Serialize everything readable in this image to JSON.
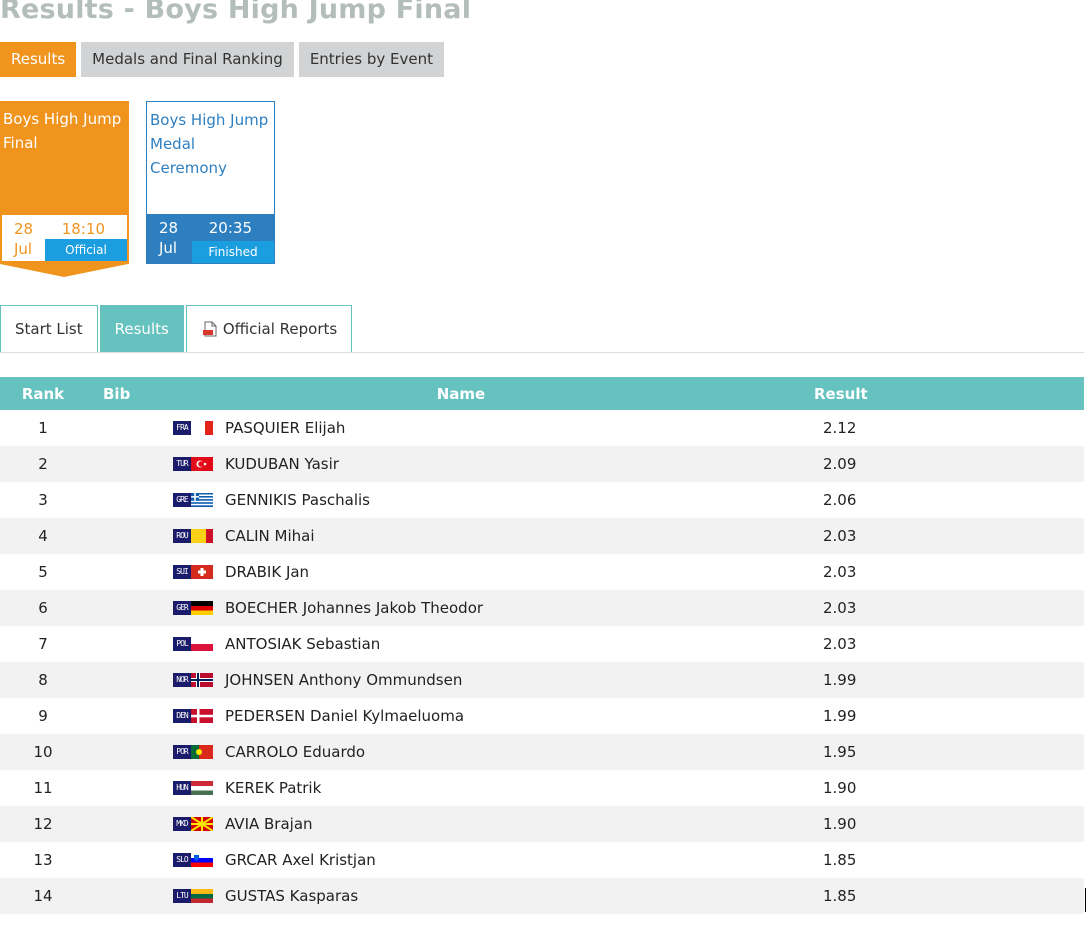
{
  "page_title": "Results - Boys High Jump Final",
  "top_tabs": [
    {
      "label": "Results",
      "active": true
    },
    {
      "label": "Medals and Final Ranking",
      "active": false
    },
    {
      "label": "Entries by Event",
      "active": false
    }
  ],
  "event_cards": [
    {
      "title": "Boys High Jump Final",
      "day": "28",
      "month": "Jul",
      "time": "18:10",
      "status": "Official",
      "selected": true
    },
    {
      "title": "Boys High Jump Medal Ceremony",
      "day": "28",
      "month": "Jul",
      "time": "20:35",
      "status": "Finished",
      "selected": false
    }
  ],
  "sub_tabs": [
    {
      "label": "Start List",
      "active": false
    },
    {
      "label": "Results",
      "active": true
    },
    {
      "label": "Official Reports",
      "active": false,
      "icon": "pdf-document-icon"
    }
  ],
  "table": {
    "headers": {
      "rank": "Rank",
      "bib": "Bib",
      "name": "Name",
      "result": "Result"
    },
    "rows": [
      {
        "rank": "1",
        "bib": "",
        "noc": "FRA",
        "name": "PASQUIER Elijah",
        "result": "2.12"
      },
      {
        "rank": "2",
        "bib": "",
        "noc": "TUR",
        "name": "KUDUBAN Yasir",
        "result": "2.09"
      },
      {
        "rank": "3",
        "bib": "",
        "noc": "GRE",
        "name": "GENNIKIS Paschalis",
        "result": "2.06"
      },
      {
        "rank": "4",
        "bib": "",
        "noc": "ROU",
        "name": "CALIN Mihai",
        "result": "2.03"
      },
      {
        "rank": "5",
        "bib": "",
        "noc": "SUI",
        "name": "DRABIK Jan",
        "result": "2.03"
      },
      {
        "rank": "6",
        "bib": "",
        "noc": "GER",
        "name": "BOECHER Johannes Jakob Theodor",
        "result": "2.03"
      },
      {
        "rank": "7",
        "bib": "",
        "noc": "POL",
        "name": "ANTOSIAK Sebastian",
        "result": "2.03"
      },
      {
        "rank": "8",
        "bib": "",
        "noc": "NOR",
        "name": "JOHNSEN Anthony Ommundsen",
        "result": "1.99"
      },
      {
        "rank": "9",
        "bib": "",
        "noc": "DEN",
        "name": "PEDERSEN Daniel Kylmaeluoma",
        "result": "1.99"
      },
      {
        "rank": "10",
        "bib": "",
        "noc": "POR",
        "name": "CARROLO Eduardo",
        "result": "1.95"
      },
      {
        "rank": "11",
        "bib": "",
        "noc": "HUN",
        "name": "KEREK Patrik",
        "result": "1.90"
      },
      {
        "rank": "12",
        "bib": "",
        "noc": "MKD",
        "name": "AVIA Brajan",
        "result": "1.90"
      },
      {
        "rank": "13",
        "bib": "",
        "noc": "SLO",
        "name": "GRCAR Axel Kristjan",
        "result": "1.85"
      },
      {
        "rank": "14",
        "bib": "",
        "noc": "LTU",
        "name": "GUSTAS Kasparas",
        "result": "1.85"
      }
    ]
  },
  "colors": {
    "accent_orange": "#f0941e",
    "teal": "#66c2bf",
    "blue": "#2e7fc0",
    "status_blue": "#1a9ee0",
    "title_grey": "#b3bdba"
  }
}
